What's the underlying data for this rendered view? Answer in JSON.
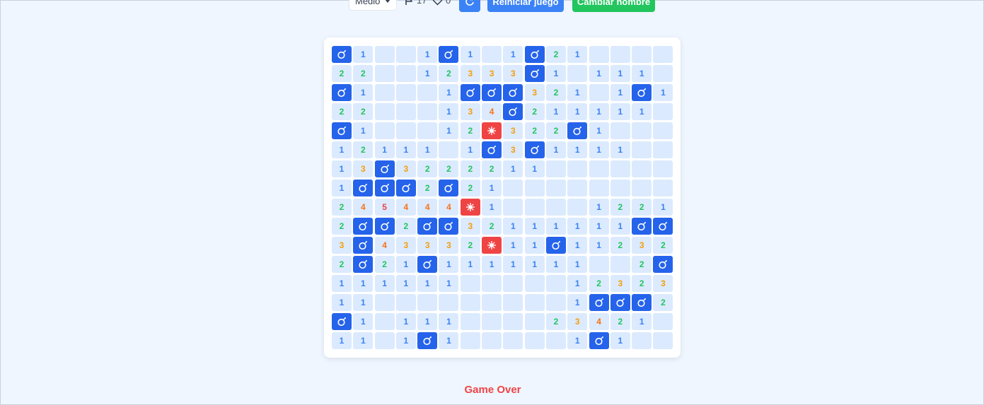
{
  "toolbar": {
    "difficulty": "Medio",
    "flags": "17",
    "lives": "0",
    "restart_label": "Reiniciar juego",
    "change_name_label": "Cambiar nombre"
  },
  "status": "Game Over",
  "colors": {
    "hidden": "#dbeafe",
    "mine": "#2563eb",
    "exploded": "#ef4444",
    "n1": "#3b82f6",
    "n2": "#22c55e",
    "n3": "#f59e0b",
    "n4": "#f97316",
    "n5": "#ef4444"
  },
  "legend": {
    "M": "mine",
    "X": "exploded-mine",
    ".": "empty",
    "1-8": "number"
  },
  "board": [
    "M1..1M1.1M21....",
    "22..12333M1.111",
    "M1...1MMM321.1M1",
    "22...134M211111",
    "M1...12X322M1...",
    "12111.1M3M1111..",
    "13M3222211......",
    "1MMM2M21........",
    "245444X1....1221",
    "2MM2MM32111111MM1",
    "3M4333 2X11M1123 2",
    "2M21M111111 1..2M",
    "111111.....12323M",
    "11.........1MMM21",
    "M1.111....2342 1.",
    "11.1M1.....1M1..."
  ]
}
